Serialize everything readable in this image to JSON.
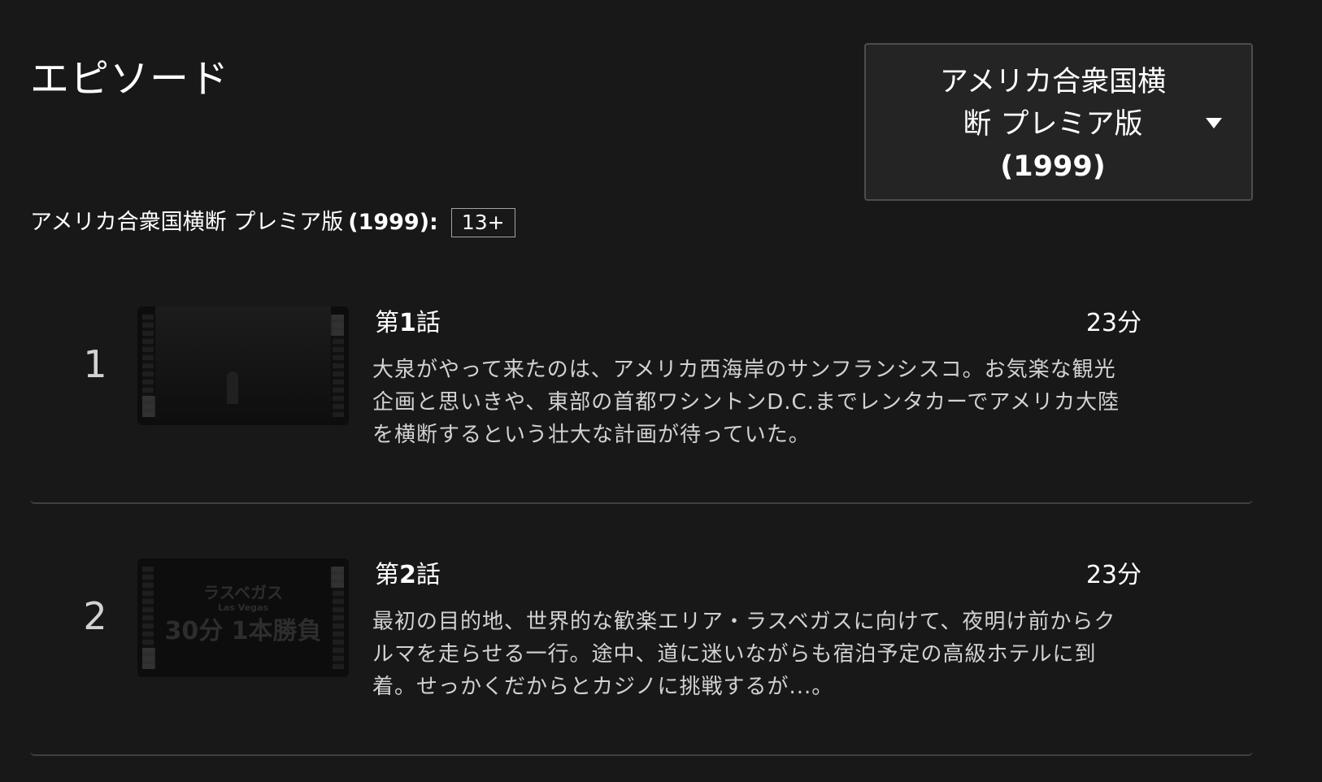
{
  "header": {
    "title": "エピソード"
  },
  "season_selector": {
    "line1": "アメリカ合衆国横",
    "line2": "断 プレミア版",
    "line3": "(1999)",
    "icon": "caret-down-icon"
  },
  "season_info": {
    "title": "アメリカ合衆国横断 プレミア版",
    "year": "(1999):",
    "maturity_rating": "13+"
  },
  "episodes": [
    {
      "index": "1",
      "title_prefix": "第",
      "title_num": "1",
      "title_suffix": "話",
      "duration": "23分",
      "desc_line1": "大泉がやって来たのは、アメリカ西海岸のサンフランシスコ。お気楽な観光",
      "desc_line2": "企画と思いきや、東部の首都ワシントンD.C.までレンタカーでアメリカ大陸",
      "desc_line3": "を横断するという壮大な計画が待っていた。"
    },
    {
      "index": "2",
      "title_prefix": "第",
      "title_num": "2",
      "title_suffix": "話",
      "duration": "23分",
      "desc_line1": "最初の目的地、世界的な歓楽エリア・ラスベガスに向けて、夜明け前からク",
      "desc_line2": "ルマを走らせる一行。途中、道に迷いながらも宿泊予定の高級ホテルに到",
      "desc_line3": "着。せっかくだからとカジノに挑戦するが...。",
      "thumb_text1": "ラスベガス",
      "thumb_text2": "Las Vegas",
      "thumb_text3": "30分 1本勝負"
    }
  ]
}
